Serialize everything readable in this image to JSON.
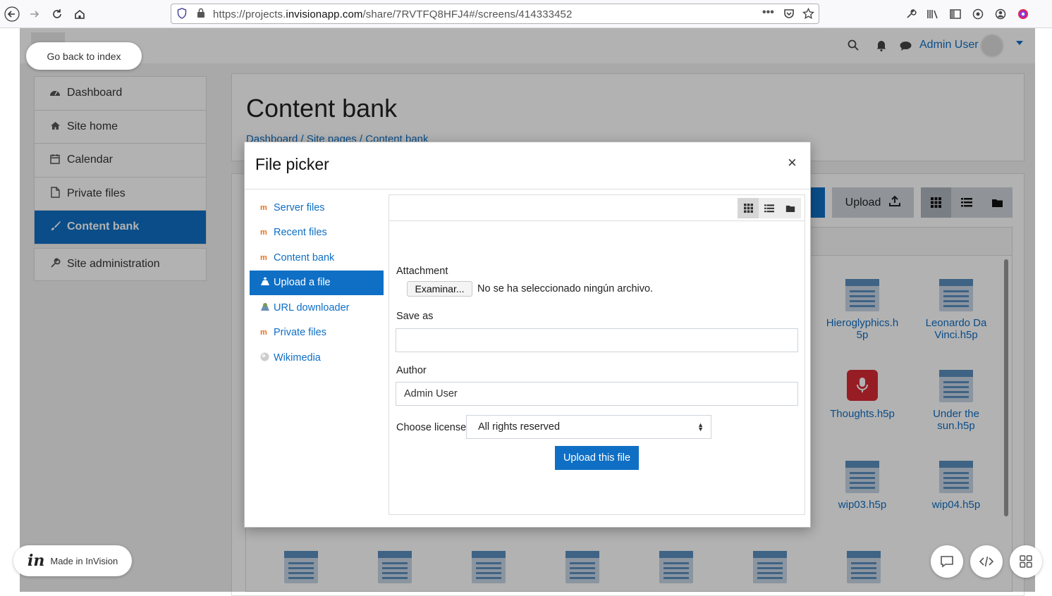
{
  "browser": {
    "url_prefix": "https://projects.",
    "url_domain": "invisionapp.com",
    "url_path": "/share/7RVTFQ8HFJ4#/screens/414333452"
  },
  "header": {
    "user_name": "Admin User"
  },
  "sidebar": {
    "items": [
      {
        "label": "Dashboard"
      },
      {
        "label": "Site home"
      },
      {
        "label": "Calendar"
      },
      {
        "label": "Private files"
      },
      {
        "label": "Content bank"
      }
    ],
    "admin_label": "Site administration"
  },
  "page": {
    "title": "Content bank",
    "breadcrumb": "Dashboard / Site pages / Content bank"
  },
  "toolbar": {
    "upload_label": "Upload"
  },
  "files": [
    {
      "name": "Hieroglyphics.h5p",
      "line1": "Hieroglyphics.h",
      "line2": "5p"
    },
    {
      "name": "Leonardo Da Vinci.h5p",
      "line1": "Leonardo Da",
      "line2": "Vinci.h5p"
    },
    {
      "name": "Thoughts.h5p",
      "line1": "Thoughts.h5p",
      "line2": ""
    },
    {
      "name": "Under the sun.h5p",
      "line1": "Under the",
      "line2": "sun.h5p"
    },
    {
      "name": "wip03.h5p",
      "line1": "wip03.h5p",
      "line2": ""
    },
    {
      "name": "wip04.h5p",
      "line1": "wip04.h5p",
      "line2": ""
    }
  ],
  "overlay": {
    "go_back": "Go back to index",
    "made_in": "Made in InVision",
    "made_in_logo": "in"
  },
  "modal": {
    "title": "File picker",
    "close": "×",
    "repositories": [
      {
        "label": "Server files"
      },
      {
        "label": "Recent files"
      },
      {
        "label": "Content bank"
      },
      {
        "label": "Upload a file"
      },
      {
        "label": "URL downloader"
      },
      {
        "label": "Private files"
      },
      {
        "label": "Wikimedia"
      }
    ],
    "attachment_label": "Attachment",
    "browse_label": "Examinar...",
    "no_file_text": "No se ha seleccionado ningún archivo.",
    "save_as_label": "Save as",
    "save_as_value": "",
    "author_label": "Author",
    "author_value": "Admin User",
    "license_label": "Choose license",
    "license_value": "All rights reserved",
    "upload_button": "Upload this file"
  }
}
